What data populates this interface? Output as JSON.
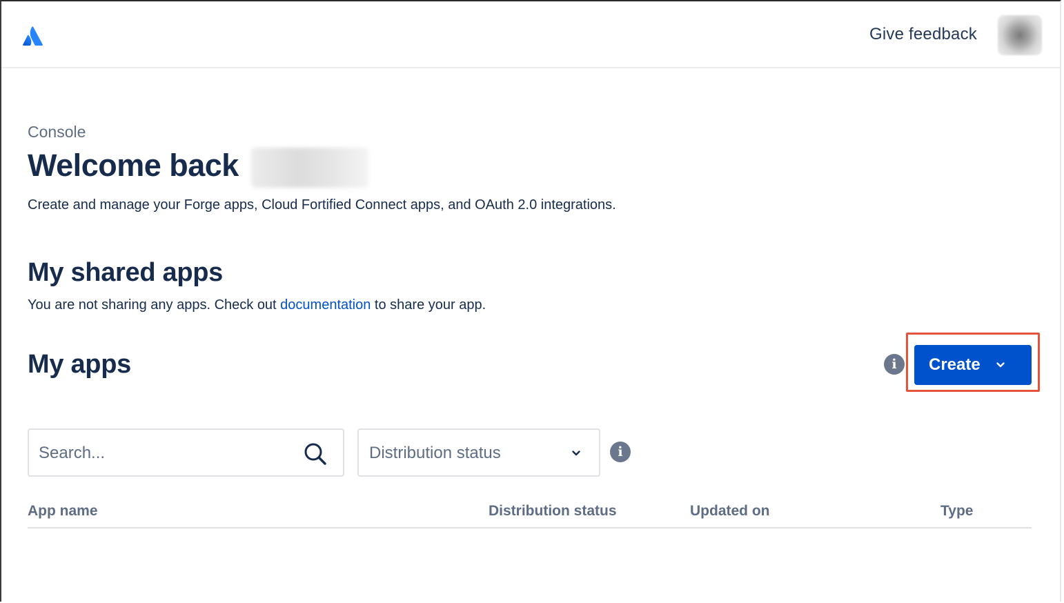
{
  "header": {
    "logo_icon": "atlassian-logo-icon",
    "feedback_label": "Give feedback",
    "avatar_icon": "user-avatar"
  },
  "page": {
    "breadcrumb": "Console",
    "welcome": "Welcome back",
    "intro": "Create and manage your Forge apps, Cloud Fortified Connect apps, and OAuth 2.0 integrations."
  },
  "shared_apps": {
    "title": "My shared apps",
    "text_before": "You are not sharing any apps. Check out ",
    "link_label": "documentation",
    "text_after": " to share your app."
  },
  "my_apps": {
    "title": "My apps",
    "info_icon": "info-icon",
    "create_label": "Create",
    "create_icon": "chevron-down-icon"
  },
  "filters": {
    "search_placeholder": "Search...",
    "search_icon": "search-icon",
    "distribution_label": "Distribution status",
    "distribution_icon": "chevron-down-icon"
  },
  "table": {
    "columns": [
      "App name",
      "Distribution status",
      "Updated on",
      "Type"
    ]
  },
  "colors": {
    "primary": "#0052cc",
    "text": "#172b4d",
    "subtle_text": "#5e6c84",
    "highlight": "#e5533d",
    "link": "#0052cc"
  }
}
